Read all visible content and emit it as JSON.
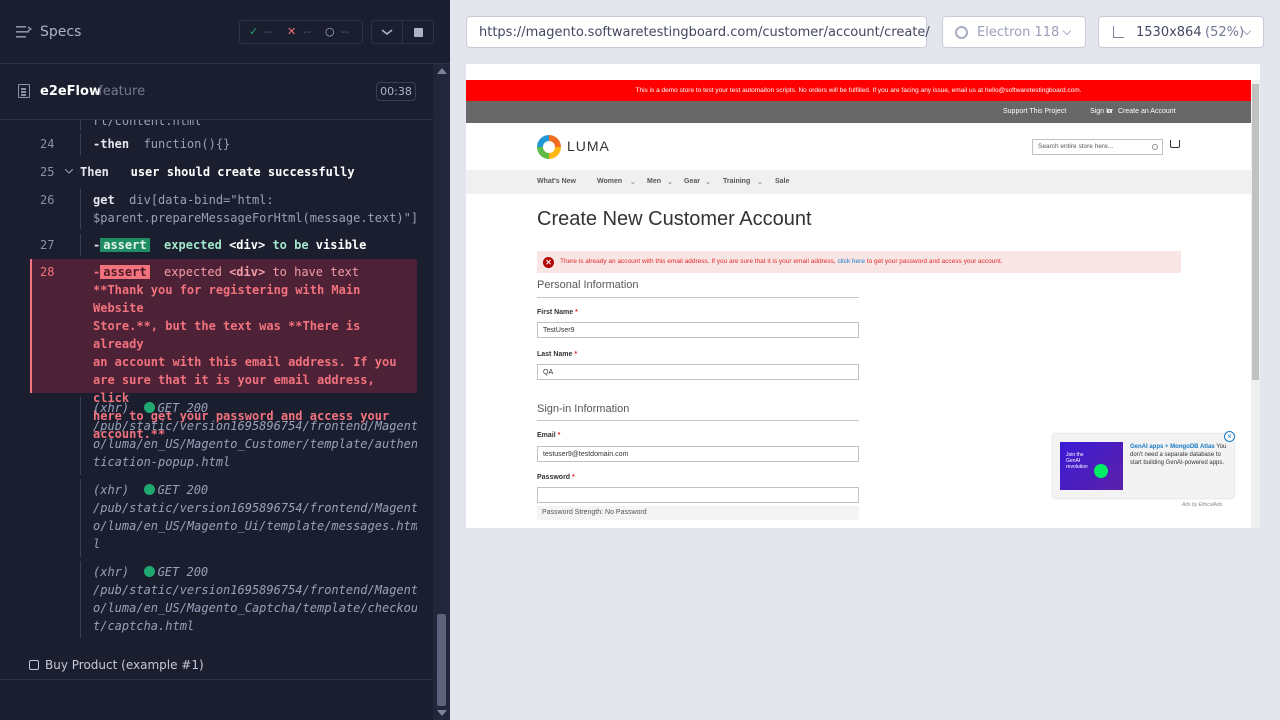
{
  "reporter": {
    "specs_label": "Specs",
    "stats": {
      "passed_icon": "✓",
      "passed": "--",
      "failed_icon": "✕",
      "failed": "--",
      "pending_icon": "○",
      "pending": "--"
    },
    "spec": {
      "name": "e2eFlow",
      "ext": ".feature",
      "duration": "00:38"
    },
    "commands": [
      {
        "num": "",
        "text_partial": "rl/content.html"
      },
      {
        "num": "24",
        "keyword": "-then",
        "args": "function(){}"
      },
      {
        "num": "25",
        "keyword": "Then",
        "message": "user should create successfully"
      },
      {
        "num": "26",
        "keyword": "get",
        "args": "div[data-bind=\"html:\n$parent.prepareMessageForHtml(message.text)\"]"
      },
      {
        "num": "27",
        "keyword": "-",
        "badge": "assert",
        "m1": "expected",
        "m2": "<div>",
        "m3": "to be",
        "m4": "visible"
      },
      {
        "num": "28",
        "keyword": "-",
        "badge": "assert",
        "m1": "expected",
        "m2": "<div>",
        "m3": "to have text",
        "detail": "**Thank you for registering with Main Website\nStore.**, but the text was **There is already\nan account with this email address. If you\nare sure that it is your email address, click\nhere to get your password and access your\naccount.**"
      },
      {
        "xhr": "(xhr)",
        "method": "GET 200",
        "url": "/pub/static/version1695896754/frontend/Magent\no/luma/en_US/Magento_Customer/template/authen\ntication-popup.html"
      },
      {
        "xhr": "(xhr)",
        "method": "GET 200",
        "url": "/pub/static/version1695896754/frontend/Magent\no/luma/en_US/Magento_Ui/template/messages.htm\nl"
      },
      {
        "xhr": "(xhr)",
        "method": "GET 200",
        "url": "/pub/static/version1695896754/frontend/Magent\no/luma/en_US/Magento_Captcha/template/checkou\nt/captcha.html"
      }
    ],
    "test_title": "Buy Product (example #1)"
  },
  "aut_header": {
    "url": "https://magento.softwaretestingboard.com/customer/account/create/",
    "browser": "Electron 118",
    "viewport": "1530x864",
    "scale": "(52%)"
  },
  "site": {
    "demo_notice": "This is a demo store to test your test automaiton scripts. No orders will be fulfilled. If you are facing any issue, email us at hello@softwaretestingboard.com.",
    "util_links": [
      "Support This Project",
      "Sign In",
      "or",
      "Create an Account"
    ],
    "logo_text": "LUMA",
    "search_placeholder": "Search entire store here...",
    "nav": [
      "What's New",
      "Women",
      "Men",
      "Gear",
      "Training",
      "Sale"
    ],
    "page_title": "Create New Customer Account",
    "error_message_pre": "There is already an account with this email address. If you are sure that it is your email address,",
    "error_message_link": "click here",
    "error_message_post": "to get your password and access your account.",
    "personal_info_title": "Personal Information",
    "first_name_label": "First Name",
    "first_name_value": "TestUser9",
    "last_name_label": "Last Name",
    "last_name_value": "QA",
    "signin_info_title": "Sign-in Information",
    "email_label": "Email",
    "email_value": "testuser9@testdomain.com",
    "password_label": "Password",
    "required_marker": "*",
    "password_strength": "Password Strength: No Password",
    "ad": {
      "image_text": "Join the GenAI revolution",
      "title": "GenAI apps + MongoDB Atlas",
      "body": "You don't need a separate database to start building GenAI-powered apps.",
      "close": "×",
      "credit": "Ads by EthicalAds"
    }
  }
}
